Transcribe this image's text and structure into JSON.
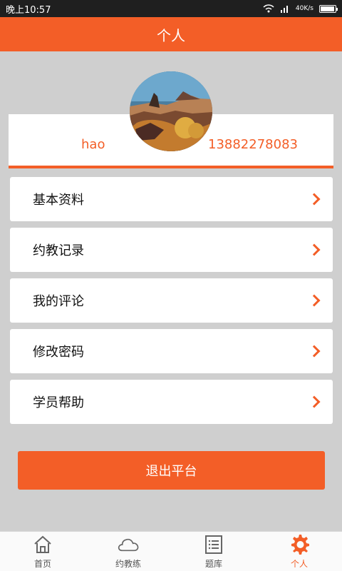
{
  "status_bar": {
    "time": "晚上10:57",
    "signal": "40K/s"
  },
  "header": {
    "title": "个人"
  },
  "profile": {
    "name": "hao",
    "phone": "13882278083"
  },
  "menu": [
    {
      "label": "基本资料"
    },
    {
      "label": "约教记录"
    },
    {
      "label": "我的评论"
    },
    {
      "label": "修改密码"
    },
    {
      "label": "学员帮助"
    }
  ],
  "logout": {
    "label": "退出平台"
  },
  "bottom_nav": [
    {
      "label": "首页",
      "icon": "home-icon"
    },
    {
      "label": "约教练",
      "icon": "cloud-icon"
    },
    {
      "label": "题库",
      "icon": "list-icon"
    },
    {
      "label": "个人",
      "icon": "gear-icon"
    }
  ],
  "colors": {
    "accent": "#f35e27",
    "background": "#cfcfcf"
  }
}
